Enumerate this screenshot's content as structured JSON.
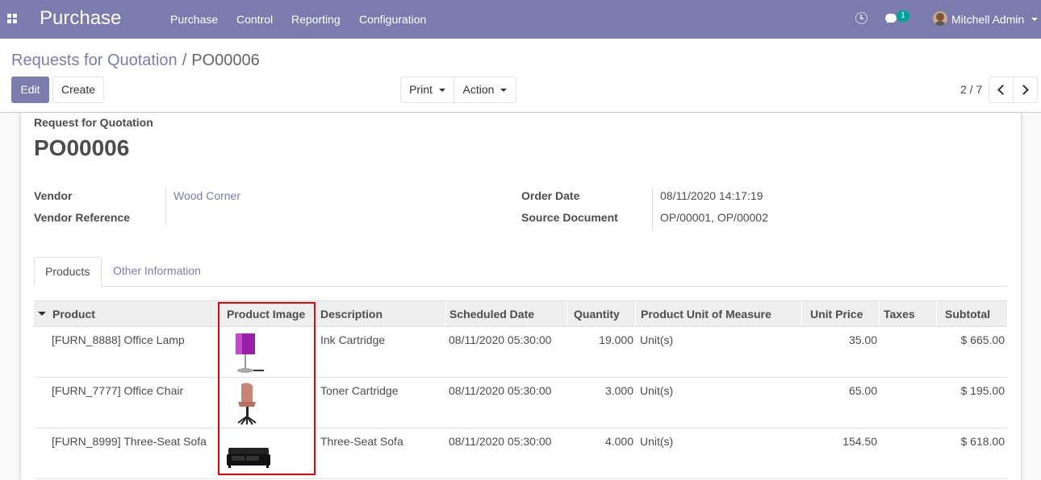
{
  "navbar": {
    "app_title": "Purchase",
    "menus": [
      "Purchase",
      "Control",
      "Reporting",
      "Configuration"
    ],
    "chat_count": "1",
    "user_name": "Mitchell Admin"
  },
  "breadcrumb": {
    "parent": "Requests for Quotation",
    "separator": "/",
    "current": "PO00006"
  },
  "buttons": {
    "edit": "Edit",
    "create": "Create",
    "print": "Print",
    "action": "Action"
  },
  "pager": {
    "value": "2 / 7"
  },
  "form": {
    "subtitle": "Request for Quotation",
    "title": "PO00006",
    "vendor_label": "Vendor",
    "vendor_value": "Wood Corner",
    "vendor_ref_label": "Vendor Reference",
    "order_date_label": "Order Date",
    "order_date_value": "08/11/2020 14:17:19",
    "source_doc_label": "Source Document",
    "source_doc_value": "OP/00001, OP/00002"
  },
  "tabs": [
    "Products",
    "Other Information"
  ],
  "table": {
    "columns": [
      "Product",
      "Product Image",
      "Description",
      "Scheduled Date",
      "Quantity",
      "Product Unit of Measure",
      "Unit Price",
      "Taxes",
      "Subtotal"
    ],
    "rows": [
      {
        "product": "[FURN_8888] Office Lamp",
        "image": "lamp",
        "description": "Ink Cartridge",
        "scheduled": "08/11/2020 05:30:00",
        "quantity": "19.000",
        "uom": "Unit(s)",
        "unit_price": "35.00",
        "taxes": "",
        "subtotal": "$ 665.00"
      },
      {
        "product": "[FURN_7777] Office Chair",
        "image": "chair",
        "description": "Toner Cartridge",
        "scheduled": "08/11/2020 05:30:00",
        "quantity": "3.000",
        "uom": "Unit(s)",
        "unit_price": "65.00",
        "taxes": "",
        "subtotal": "$ 195.00"
      },
      {
        "product": "[FURN_8999] Three-Seat Sofa",
        "image": "sofa",
        "description": "Three-Seat Sofa",
        "scheduled": "08/11/2020 05:30:00",
        "quantity": "4.000",
        "uom": "Unit(s)",
        "unit_price": "154.50",
        "taxes": "",
        "subtotal": "$ 618.00"
      }
    ]
  },
  "colors": {
    "brand": "#7c7bad",
    "highlight": "#e8000d"
  }
}
